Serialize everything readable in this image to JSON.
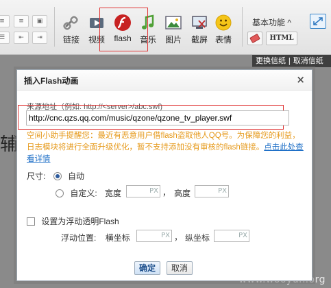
{
  "toolbar": {
    "tools": [
      {
        "name": "link",
        "label": "链接",
        "icon": "link-icon"
      },
      {
        "name": "video",
        "label": "视频",
        "icon": "video-icon"
      },
      {
        "name": "flash",
        "label": "flash",
        "icon": "flash-icon"
      },
      {
        "name": "music",
        "label": "音乐",
        "icon": "music-icon"
      },
      {
        "name": "image",
        "label": "图片",
        "icon": "image-icon"
      },
      {
        "name": "screenshot",
        "label": "截屏",
        "icon": "screenshot-icon"
      },
      {
        "name": "emoji",
        "label": "表情",
        "icon": "emoji-icon"
      }
    ],
    "basic_features": "基本功能 ^",
    "html_label": "HTML"
  },
  "page": {
    "stationery_bar": "更换信纸 | 取消信纸",
    "bg_char": "辅",
    "watermark": "www.wooyun.org"
  },
  "dialog": {
    "title": "插入Flash动画",
    "close": "×",
    "source_label": "来源地址（例如: http://<server>/abc.swf)",
    "url_value": "http://cnc.qzs.qq.com/music/qzone/qzone_tv_player.swf",
    "tip_text": "空间小助手提醒您：最近有恶意用户借flash盗取他人QQ号。为保障您的利益，日志模块将进行全面升级优化，暂不支持添加没有审核的flash链接。",
    "tip_link": "点击此处查看详情",
    "size_label": "尺寸:",
    "auto_label": "自动",
    "custom_label": "自定义:",
    "width_label": "宽度",
    "height_label": "高度",
    "px": "PX",
    "comma": "，",
    "float_label": "设置为浮动透明Flash",
    "float_pos_label": "浮动位置:",
    "xcoord_label": "横坐标",
    "ycoord_label": "纵坐标",
    "ok": "确定",
    "cancel": "取消"
  }
}
